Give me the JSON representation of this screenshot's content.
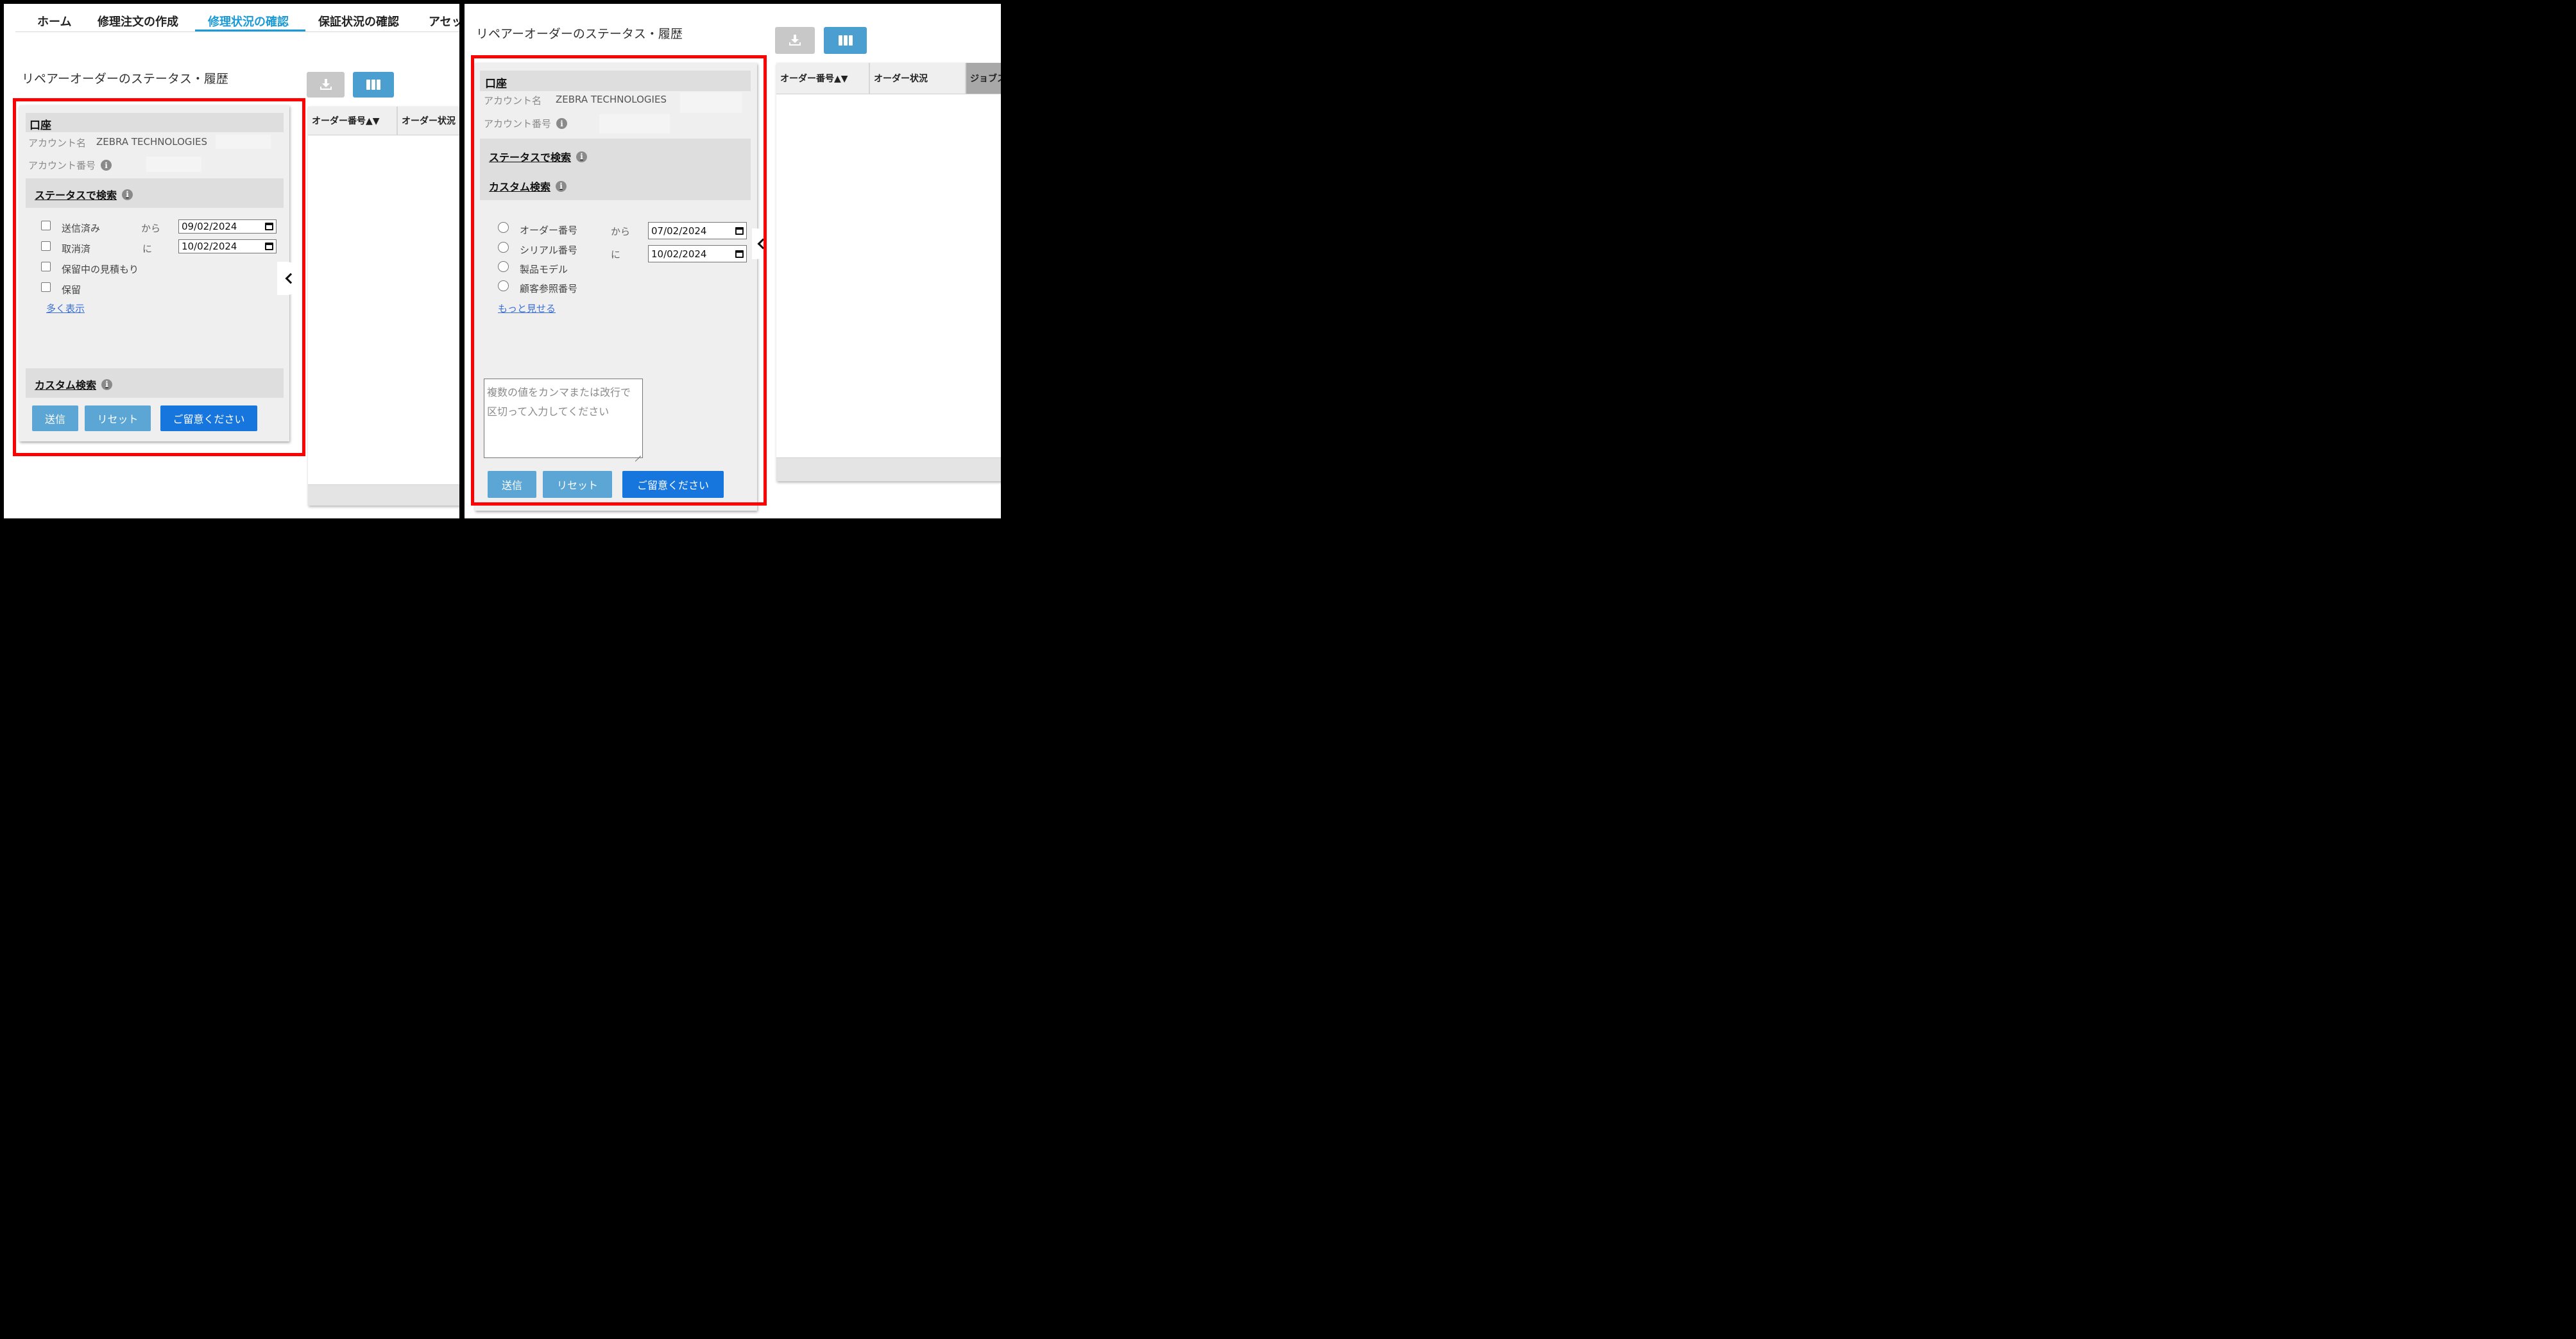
{
  "nav": {
    "items": [
      "ホーム",
      "修理注文の作成",
      "修理状況の確認",
      "保証状況の確認",
      "アセッ"
    ],
    "active_index": 2
  },
  "page": {
    "title": "リペアーオーダーのステータス・履歴"
  },
  "toolbar": {
    "download_icon": "download-icon",
    "columns_icon": "columns-icon"
  },
  "left_panel": {
    "account_section": {
      "title": "口座",
      "account_name_label": "アカウント名",
      "account_name_value": "ZEBRA TECHNOLOGIES",
      "account_number_label": "アカウント番号"
    },
    "status_search": {
      "title": "ステータスで検索",
      "options": [
        "送信済み",
        "取消済",
        "保留中の見積もり",
        "保留"
      ],
      "from_label": "から",
      "to_label": "に",
      "from_date": "09/02/2024",
      "to_date": "10/02/2024",
      "more_link": "多く表示"
    },
    "custom_search": {
      "title": "カスタム検索"
    },
    "buttons": {
      "submit": "送信",
      "reset": "リセット",
      "notice": "ご留意ください"
    }
  },
  "right_panel": {
    "title": "リペアーオーダーのステータス・履歴",
    "account_section": {
      "title": "口座",
      "account_name_label": "アカウント名",
      "account_name_value": "ZEBRA TECHNOLOGIES",
      "account_number_label": "アカウント番号"
    },
    "status_search": {
      "title": "ステータスで検索"
    },
    "custom_search": {
      "title": "カスタム検索",
      "options": [
        "オーダー番号",
        "シリアル番号",
        "製品モデル",
        "顧客参照番号"
      ],
      "from_label": "から",
      "to_label": "に",
      "from_date": "07/02/2024",
      "to_date": "10/02/2024",
      "more_link": "もっと見せる",
      "textarea_placeholder": "複数の値をカンマまたは改行で区切って入力してください"
    },
    "buttons": {
      "submit": "送信",
      "reset": "リセット",
      "notice": "ご留意ください"
    }
  },
  "table_left": {
    "columns": [
      "オーダー番号▲▼",
      "オーダー状況"
    ]
  },
  "table_right": {
    "columns": [
      "オーダー番号▲▼",
      "オーダー状況",
      "ジョブス"
    ]
  },
  "colors": {
    "accent": "#1a9ad6",
    "highlight": "#ff0000",
    "primary_button": "#1676de",
    "secondary_button": "#5ba6d4"
  }
}
